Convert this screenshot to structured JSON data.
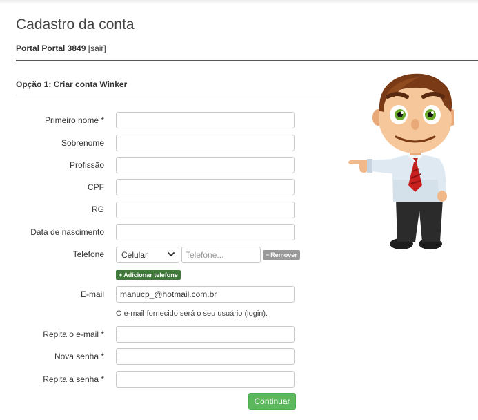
{
  "page": {
    "title": "Cadastro da conta",
    "account_name": "Portal Portal 3849",
    "logout_label": "[sair]"
  },
  "section": {
    "title": "Opção 1: Criar conta Winker"
  },
  "form": {
    "first_name": {
      "label": "Primeiro nome *",
      "value": ""
    },
    "last_name": {
      "label": "Sobrenome",
      "value": ""
    },
    "profession": {
      "label": "Profissão",
      "value": ""
    },
    "cpf": {
      "label": "CPF",
      "value": ""
    },
    "rg": {
      "label": "RG",
      "value": ""
    },
    "birth_date": {
      "label": "Data de nascimento",
      "value": ""
    },
    "phone": {
      "label": "Telefone",
      "type_selected": "Celular",
      "placeholder": "Telefone...",
      "remove_label": "Remover",
      "add_label": "Adicionar telefone"
    },
    "email": {
      "label": "E-mail",
      "value": "manucp_@hotmail.com.br",
      "help": "O e-mail fornecido será o seu usuário (login)."
    },
    "email_repeat": {
      "label": "Repita o e-mail *",
      "value": ""
    },
    "new_password": {
      "label": "Nova senha *",
      "value": ""
    },
    "password_repeat": {
      "label": "Repita a senha *",
      "value": ""
    },
    "continue_label": "Continuar"
  },
  "colors": {
    "continue_button": "#5cb85c",
    "add_button": "#3f7a3a",
    "remove_button": "#999999",
    "divider": "#555555"
  }
}
